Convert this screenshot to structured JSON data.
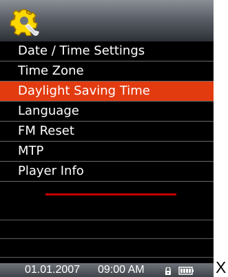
{
  "header": {
    "icon": "settings-gear-wrench-icon"
  },
  "menu": {
    "items": [
      {
        "label": "Date / Time Settings",
        "selected": false
      },
      {
        "label": "Time Zone",
        "selected": false
      },
      {
        "label": "Daylight Saving Time",
        "selected": true
      },
      {
        "label": "Language",
        "selected": false
      },
      {
        "label": "FM Reset",
        "selected": false
      },
      {
        "label": "MTP",
        "selected": false
      },
      {
        "label": "Player Info",
        "selected": false
      }
    ]
  },
  "status_bar": {
    "date": "01.01.2007",
    "time": "09:00 AM",
    "lock_icon": "lock-icon",
    "battery_icon": "battery-icon"
  },
  "outside_text": "X",
  "colors": {
    "selected": "#e23b10",
    "separator": "#c40000",
    "screen_background": "#000000"
  }
}
